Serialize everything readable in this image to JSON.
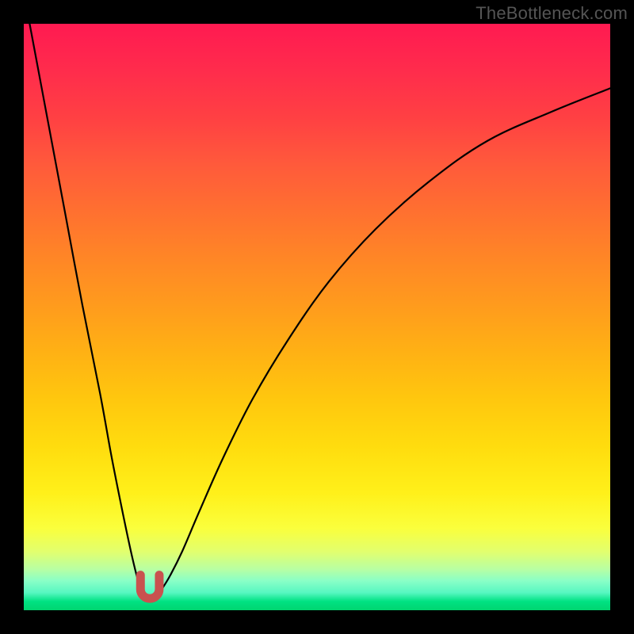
{
  "watermark": "TheBottleneck.com",
  "colors": {
    "frame": "#000000",
    "curve": "#000000",
    "marker_fill": "#c9524f",
    "marker_stroke": "#c9524f"
  },
  "chart_data": {
    "type": "line",
    "title": "",
    "xlabel": "",
    "ylabel": "",
    "xlim": [
      0,
      100
    ],
    "ylim": [
      0,
      100
    ],
    "grid": false,
    "legend": false,
    "description": "Bottleneck-style V curve on vertical rainbow gradient. Left branch descends steeply from top-left to a minimum around x≈21; right branch rises with decreasing slope toward the upper-right. A small red U-shaped marker sits at the valley bottom (~2% above the x-axis).",
    "series": [
      {
        "name": "left-branch",
        "x": [
          1,
          4,
          7,
          10,
          13,
          15,
          17,
          18.5,
          19.5,
          20.25,
          20.75,
          21
        ],
        "values": [
          100,
          84,
          68,
          52,
          37,
          26,
          16,
          9,
          5,
          2.8,
          1.8,
          1.5
        ]
      },
      {
        "name": "right-branch",
        "x": [
          22,
          22.75,
          23.5,
          25,
          27,
          30,
          34,
          39,
          45,
          52,
          60,
          69,
          79,
          90,
          100
        ],
        "values": [
          1.5,
          2.2,
          3.5,
          6,
          10,
          17,
          26,
          36,
          46,
          56,
          65,
          73,
          80,
          85,
          89
        ]
      }
    ],
    "marker": {
      "name": "valley-marker",
      "shape": "U",
      "x_center": 21.5,
      "y_base": 2.0,
      "width": 3.2,
      "height": 4.0
    }
  }
}
